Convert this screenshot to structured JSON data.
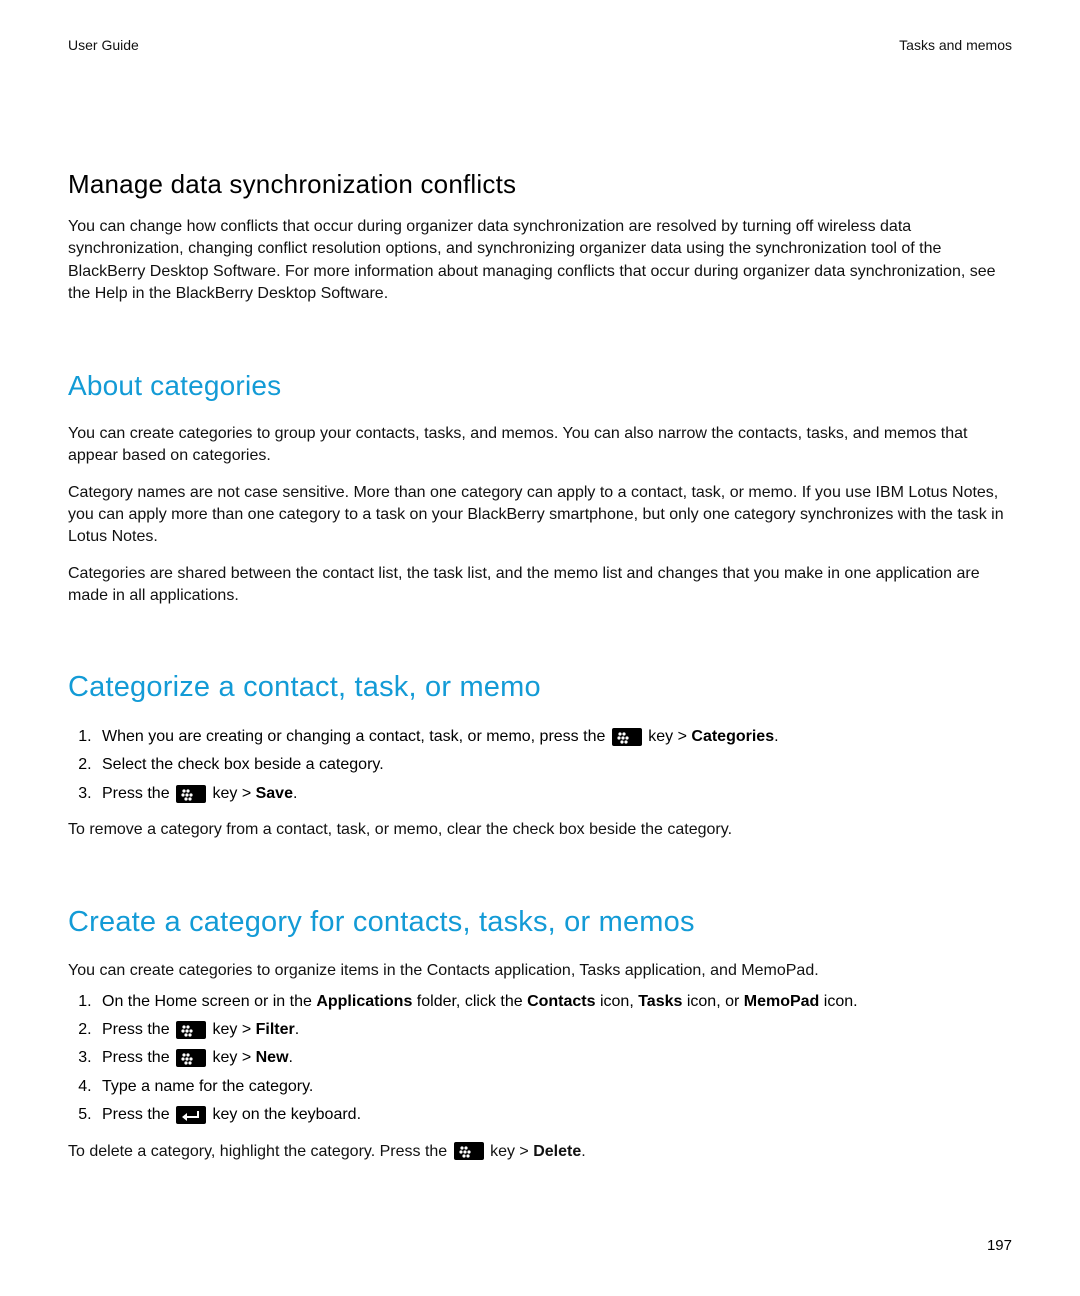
{
  "header": {
    "left": "User Guide",
    "right": "Tasks and memos"
  },
  "s1": {
    "title": "Manage data synchronization conflicts",
    "p1": "You can change how conflicts that occur during organizer data synchronization are resolved by turning off wireless data synchronization, changing conflict resolution options, and synchronizing organizer data using the synchronization tool of the BlackBerry Desktop Software. For more information about managing conflicts that occur during organizer data synchronization, see the Help in the BlackBerry Desktop Software."
  },
  "s2": {
    "title": "About categories",
    "p1": "You can create categories to group your contacts, tasks, and memos. You can also narrow the contacts, tasks, and memos that appear based on categories.",
    "p2": "Category names are not case sensitive. More than one category can apply to a contact, task, or memo. If you use IBM Lotus Notes, you can apply more than one category to a task on your BlackBerry smartphone, but only one category synchronizes with the task in Lotus Notes.",
    "p3": "Categories are shared between the contact list, the task list, and the memo list and changes that you make in one application are made in all applications."
  },
  "s3": {
    "title": "Categorize a contact, task, or memo",
    "li1a": "When you are creating or changing a contact, task, or memo, press the ",
    "li1b": " key > ",
    "li1c": "Categories",
    "li1d": ".",
    "li2": "Select the check box beside a category.",
    "li3a": "Press the ",
    "li3b": " key > ",
    "li3c": "Save",
    "li3d": ".",
    "after": "To remove a category from a contact, task, or memo, clear the check box beside the category."
  },
  "s4": {
    "title": "Create a category for contacts, tasks, or memos",
    "intro": "You can create categories to organize items in the Contacts application, Tasks application, and MemoPad.",
    "li1a": "On the Home screen or in the ",
    "li1b": "Applications",
    "li1c": " folder, click the ",
    "li1d": "Contacts",
    "li1e": " icon, ",
    "li1f": "Tasks",
    "li1g": " icon, or ",
    "li1h": "MemoPad",
    "li1i": " icon.",
    "li2a": "Press the ",
    "li2b": " key > ",
    "li2c": "Filter",
    "li2d": ".",
    "li3a": "Press the ",
    "li3b": " key > ",
    "li3c": "New",
    "li3d": ".",
    "li4": "Type a name for the category.",
    "li5a": "Press the ",
    "li5b": " key on the keyboard.",
    "afterA": "To delete a category, highlight the category. Press the ",
    "afterB": " key > ",
    "afterC": "Delete",
    "afterD": "."
  },
  "page_number": "197"
}
